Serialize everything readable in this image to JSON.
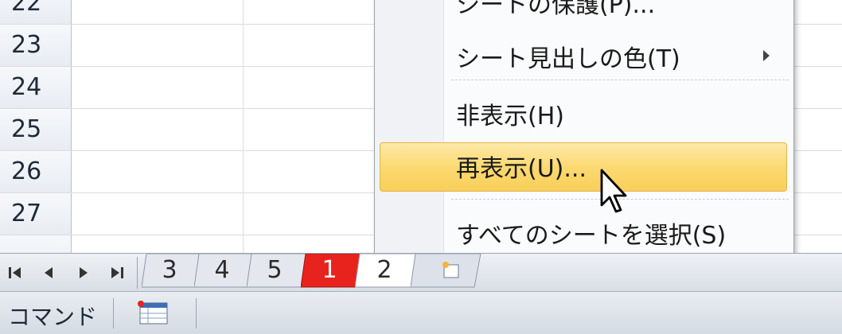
{
  "rows": [
    "23",
    "24",
    "25",
    "26",
    "27"
  ],
  "context_menu": {
    "items": [
      {
        "label": "シートの保護(P)...",
        "partial": true
      },
      {
        "label": "シート見出しの色(T)",
        "submenu": true
      },
      {
        "label": "非表示(H)"
      },
      {
        "label": "再表示(U)...",
        "hovered": true
      },
      {
        "label": "すべてのシートを選択(S)"
      }
    ]
  },
  "sheet_tabs": {
    "tabs": [
      {
        "label": "3"
      },
      {
        "label": "4"
      },
      {
        "label": "5"
      },
      {
        "label": "1",
        "color": "#e8231e"
      },
      {
        "label": "2",
        "active": true
      }
    ],
    "new_sheet_icon": "insert-sheet-icon"
  },
  "status_bar": {
    "mode": "コマンド",
    "view_icon": "normal-view-icon"
  },
  "colors": {
    "hover_highlight": "#fbd86e",
    "tab_red": "#e8231e"
  }
}
